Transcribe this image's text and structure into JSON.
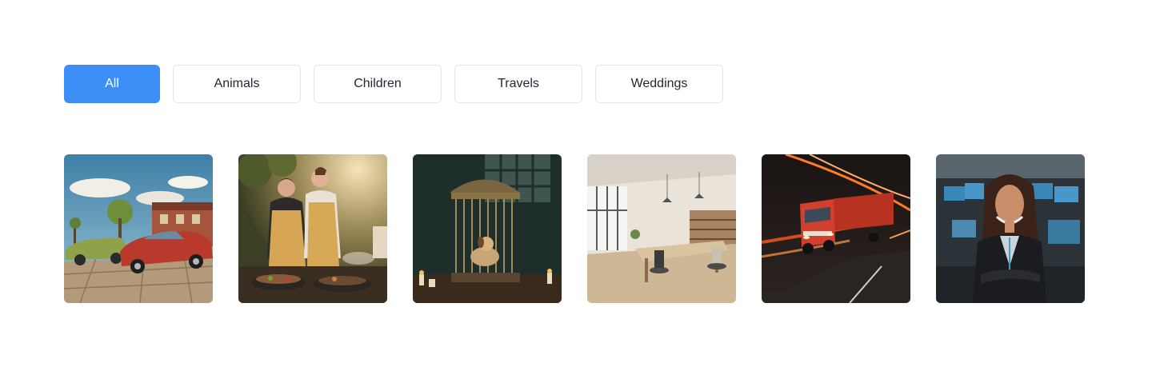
{
  "filters": {
    "all": "All",
    "animals": "Animals",
    "children": "Children",
    "travels": "Travels",
    "weddings": "Weddings",
    "active": "All"
  },
  "colors": {
    "accent": "#3b8ff6",
    "button_border": "#e3e5e8",
    "text": "#222831"
  },
  "gallery": {
    "items": [
      {
        "subject": "vintage cars on street"
      },
      {
        "subject": "couple cooking outdoors"
      },
      {
        "subject": "dog in birdcage"
      },
      {
        "subject": "bright office interior"
      },
      {
        "subject": "red truck speeding"
      },
      {
        "subject": "businesswoman in office"
      }
    ]
  }
}
